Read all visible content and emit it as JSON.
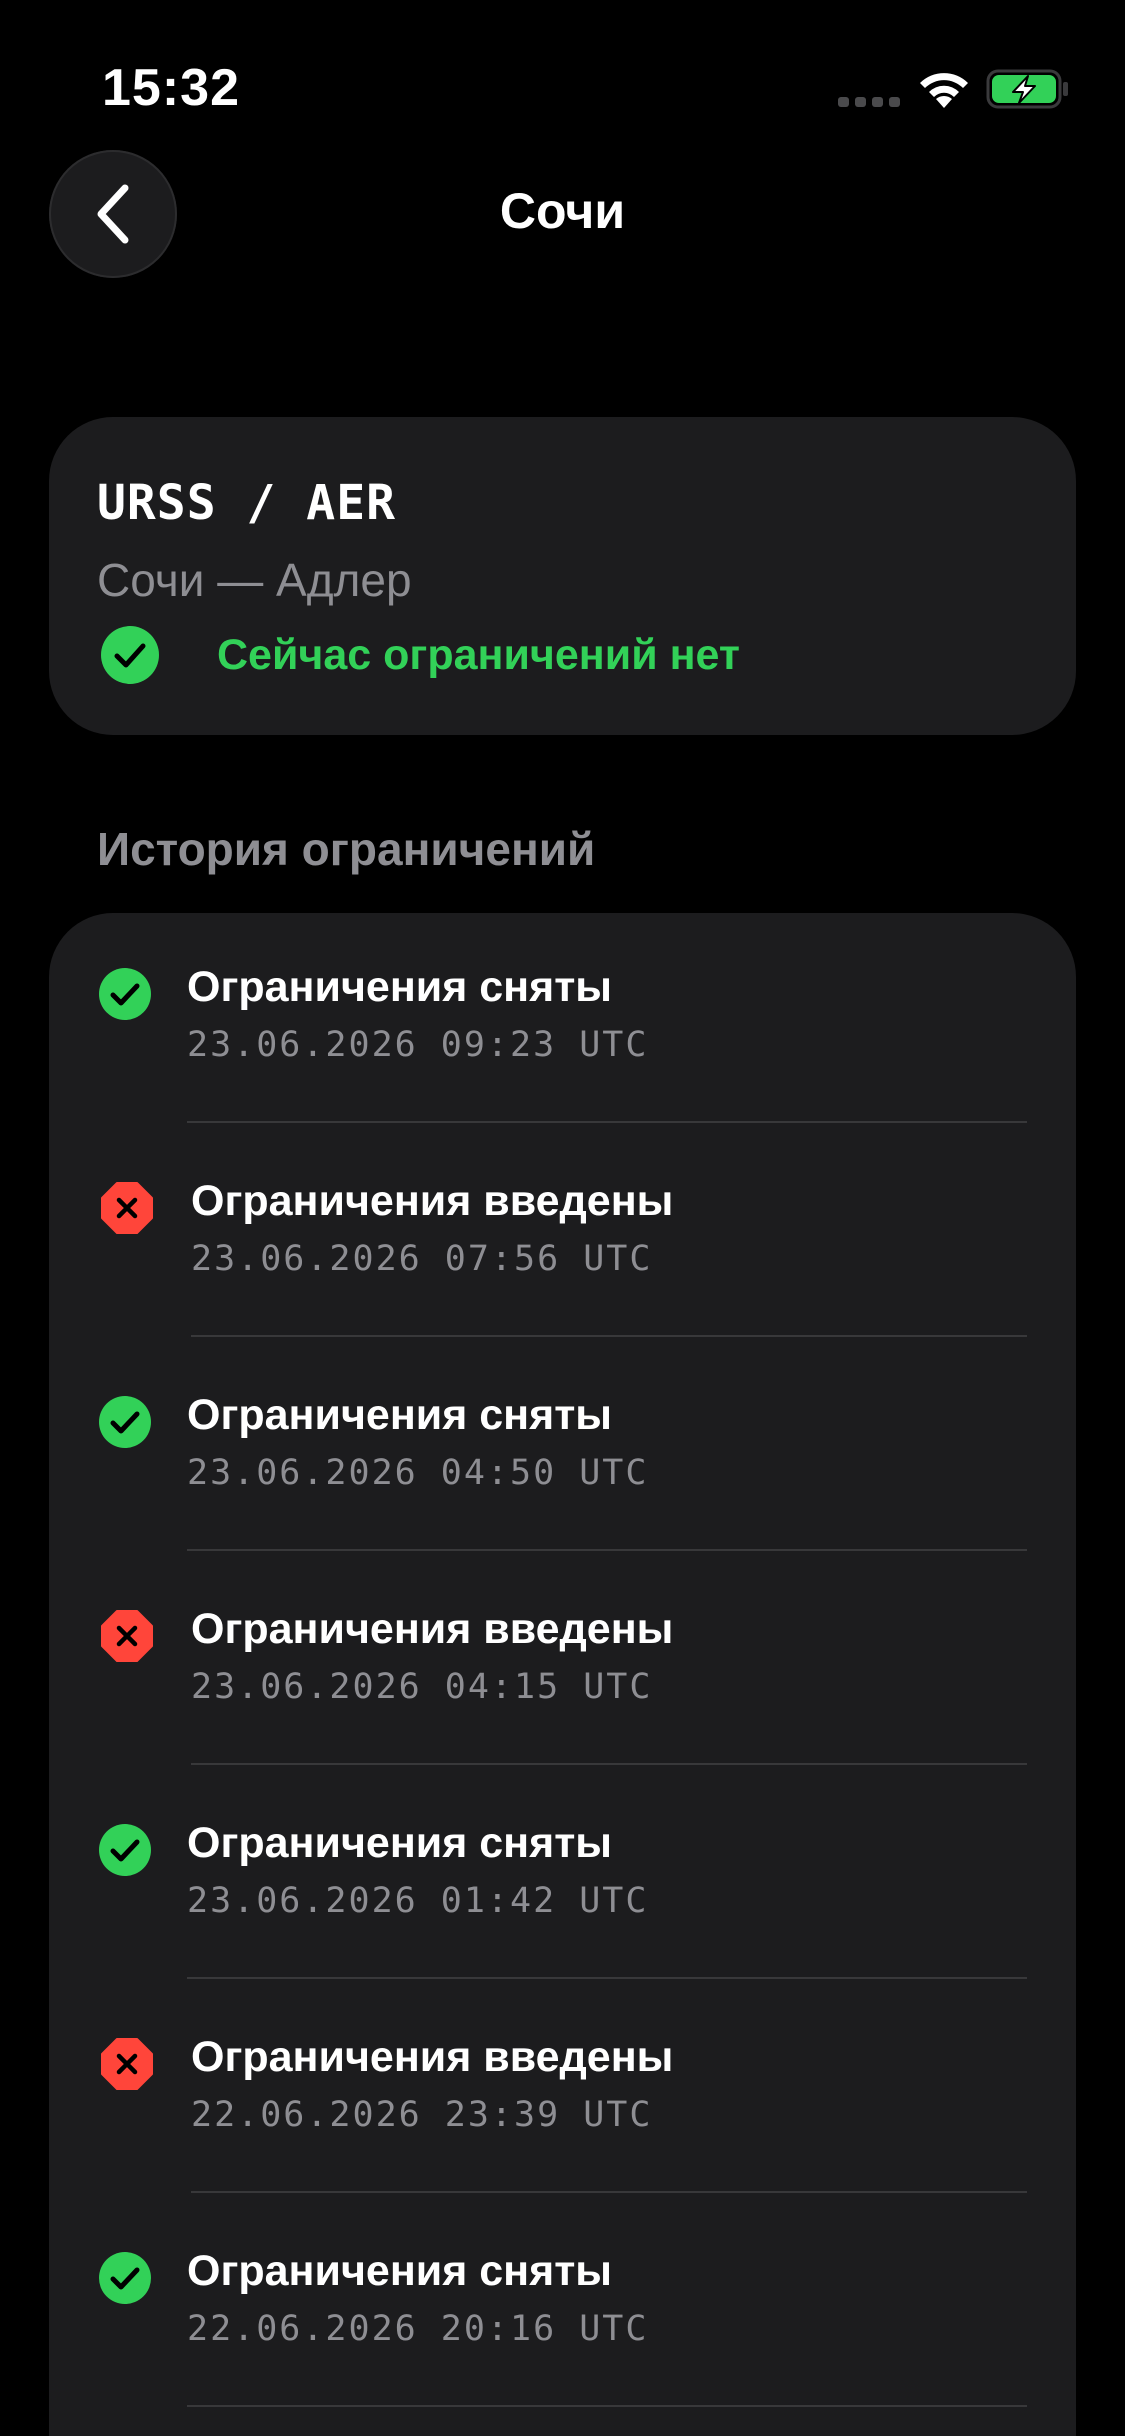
{
  "status_bar": {
    "time": "15:32"
  },
  "nav": {
    "title": "Сочи",
    "back_icon": "chevron-left-icon"
  },
  "airport": {
    "code": "URSS / AER",
    "name": "Сочи — Адлер",
    "current_status": "Сейчас ограничений нет",
    "current_status_icon": "checkmark-circle-icon"
  },
  "history": {
    "title": "История ограничений",
    "items": [
      {
        "type": "lifted",
        "label": "Ограничения сняты",
        "time": "23.06.2026 09:23 UTC"
      },
      {
        "type": "imposed",
        "label": "Ограничения введены",
        "time": "23.06.2026 07:56 UTC"
      },
      {
        "type": "lifted",
        "label": "Ограничения сняты",
        "time": "23.06.2026 04:50 UTC"
      },
      {
        "type": "imposed",
        "label": "Ограничения введены",
        "time": "23.06.2026 04:15 UTC"
      },
      {
        "type": "lifted",
        "label": "Ограничения сняты",
        "time": "23.06.2026 01:42 UTC"
      },
      {
        "type": "imposed",
        "label": "Ограничения введены",
        "time": "22.06.2026 23:39 UTC"
      },
      {
        "type": "lifted",
        "label": "Ограничения сняты",
        "time": "22.06.2026 20:16 UTC"
      }
    ]
  },
  "colors": {
    "background": "#000000",
    "card": "#1c1c1e",
    "success": "#32d158",
    "danger": "#ff453a",
    "secondary_text": "#8e8e93",
    "divider": "#38383a"
  }
}
